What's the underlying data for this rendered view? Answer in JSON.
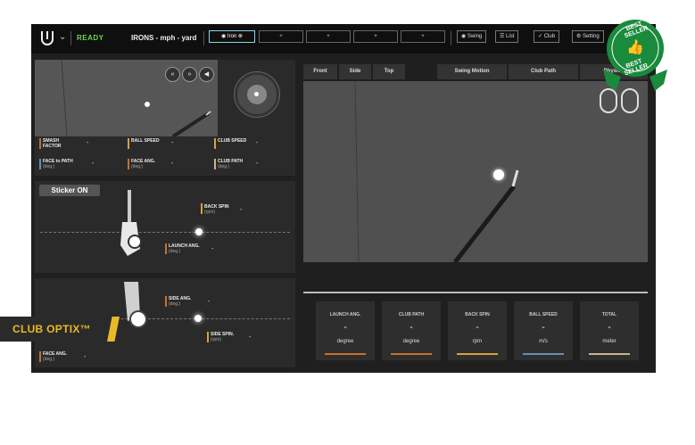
{
  "header": {
    "status": "READY",
    "mode": "IRONS - mph - yard",
    "club_slot_active": "Iron",
    "empty_slot_symbol": "+",
    "buttons": {
      "swing": "Swing",
      "list": "List",
      "club": "Club",
      "setting": "Setting"
    }
  },
  "left_stats": {
    "smash_factor": "SMASH FACTOR",
    "ball_speed": "BALL SPEED",
    "club_speed": "CLUB SPEED",
    "face_to_path": "FACE to PATH",
    "face_ang": "FACE ANG.",
    "club_path": "CLUB PATH",
    "unit_deg": "(deg.)",
    "value": "-"
  },
  "side_panel": {
    "sticker": "Sticker ON",
    "back_spin": "BACK SPIN",
    "rpm": "(rpm)",
    "launch_ang": "LAUNCH ANG.",
    "deg": "(deg.)"
  },
  "top_panel": {
    "side_ang": "SIDE ANG.",
    "side_spin": "SIDE SPIN.",
    "face_ang": "FACE ANG.",
    "deg": "(deg.)",
    "rpm": "(rpm)"
  },
  "view_tabs": [
    "Front",
    "Side",
    "Top",
    "Swing Motion",
    "Club Path",
    "Physics"
  ],
  "summary": [
    {
      "title": "LAUNCH ANG.",
      "value": "-",
      "unit": "degree",
      "color": "#c8702a"
    },
    {
      "title": "CLUB PATH",
      "value": "-",
      "unit": "degree",
      "color": "#c8702a"
    },
    {
      "title": "BACK SPIN",
      "value": "-",
      "unit": "rpm",
      "color": "#d9a13a"
    },
    {
      "title": "BALL SPEED",
      "value": "-",
      "unit": "m/s",
      "color": "#6a8fb0"
    },
    {
      "title": "TOTAL",
      "value": "-",
      "unit": "meter",
      "color": "#c9b48a"
    }
  ],
  "badge": {
    "top": "BEST SELLER",
    "bottom": "BEST SELLER",
    "color": "#1a8a3c"
  },
  "club_optix_label": "CLUB OPTIX™"
}
